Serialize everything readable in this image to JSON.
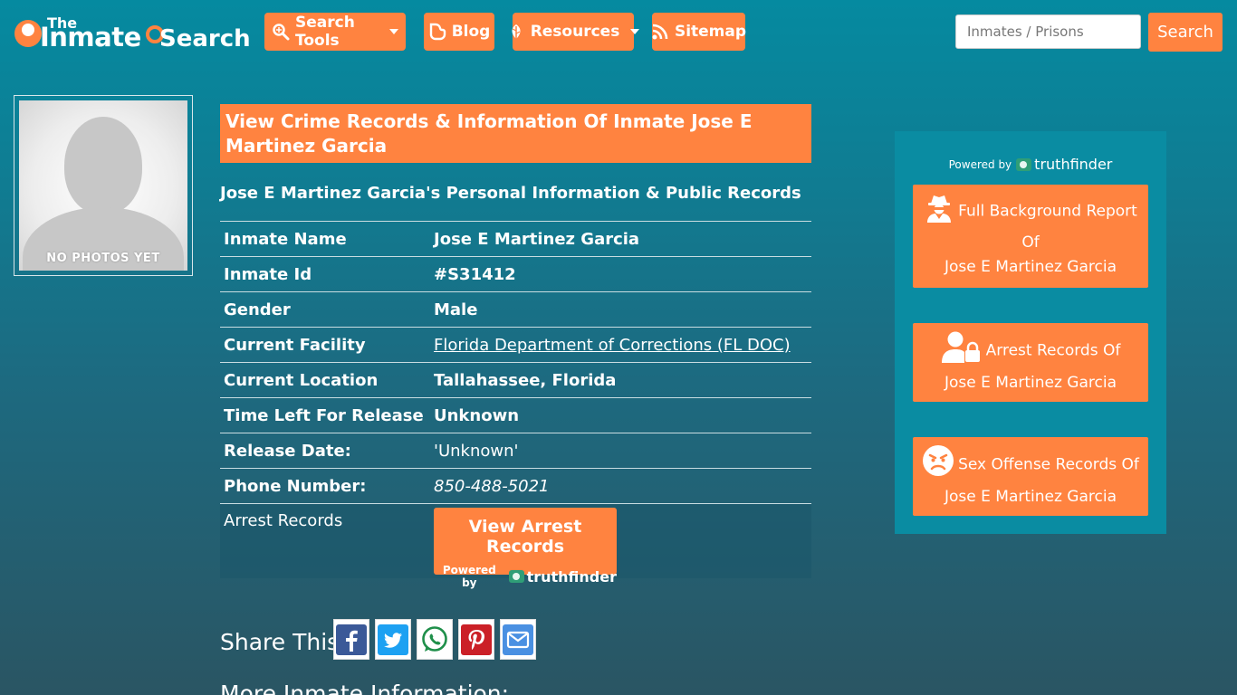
{
  "header": {
    "logo": {
      "the": "The",
      "inmate": "Inmate",
      "search": "Search"
    },
    "nav": [
      {
        "label": "Search Tools",
        "icon": "search-tools-icon",
        "dropdown": true
      },
      {
        "label": "Blog",
        "icon": "blogger-icon",
        "dropdown": false
      },
      {
        "label": "Resources",
        "icon": "leaf-icon",
        "dropdown": true
      },
      {
        "label": "Sitemap",
        "icon": "rss-icon",
        "dropdown": false
      }
    ],
    "search": {
      "placeholder": "Inmates / Prisons",
      "button": "Search"
    }
  },
  "photo": {
    "label": "NO PHOTOS YET"
  },
  "main": {
    "title": "View Crime Records & Information Of Inmate Jose E Martinez Garcia",
    "subtitle": "Jose E Martinez Garcia's Personal Information & Public Records",
    "rows": [
      {
        "key": "Inmate Name",
        "value": "Jose E Martinez Garcia"
      },
      {
        "key": "Inmate Id",
        "value": "#S31412"
      },
      {
        "key": "Gender",
        "value": "Male"
      },
      {
        "key": "Current Facility",
        "value": "Florida Department of Corrections (FL DOC)"
      },
      {
        "key": "Current Location",
        "value": "Tallahassee, Florida"
      },
      {
        "key": "Time Left For Release",
        "value": "Unknown"
      },
      {
        "key": "Release Date:",
        "value": "'Unknown'"
      },
      {
        "key": "Phone Number:",
        "value": "850-488-5021"
      }
    ],
    "arrest": {
      "key": "Arrest Records",
      "button": "View Arrest Records",
      "powered": "Powered by",
      "brand": "truthfinder"
    },
    "share": {
      "label": "Share This:"
    },
    "more": "More Inmate Information:"
  },
  "side": {
    "powered": "Powered by",
    "brand": "truthfinder",
    "cards": [
      {
        "line1": "Full Background Report",
        "line2": "Of",
        "line3": "Jose E Martinez Garcia"
      },
      {
        "line1": "Arrest Records Of",
        "line2": "Jose E Martinez Garcia"
      },
      {
        "line1": "Sex Offense Records Of",
        "line2": "Jose E Martinez Garcia"
      }
    ]
  },
  "colors": {
    "accent": "#ff8340",
    "panel": "#0a8ca2",
    "facebook": "#3b5998",
    "twitter": "#1da1f2",
    "whatsapp": "#25d366",
    "pinterest": "#cb2027",
    "email": "#4a90e2"
  }
}
